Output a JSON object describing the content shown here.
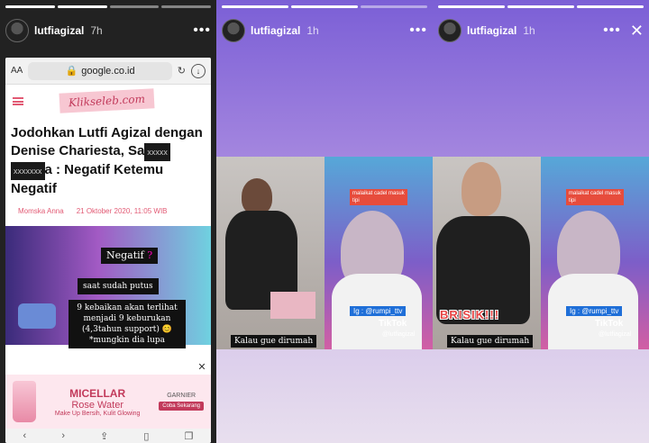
{
  "stories": [
    {
      "username": "lutfiagizal",
      "time": "7h",
      "more": "•••",
      "browser": {
        "aa_label": "AA",
        "url": "google.co.id",
        "reload_icon": "reload-icon",
        "download_icon": "download-icon",
        "logo": "Klikseleb.com",
        "headline_part1": "Jodohkan Lutfi Agizal dengan Denise Chariesta, Sa",
        "redact1": "xxxxx",
        "redact2": "xxxxxxx",
        "headline_part2": "a : Negatif Ketemu Negatif",
        "author": "Momska Anna",
        "date": "21 Oktober 2020, 11:05 WIB",
        "note1_prefix": "Negatif",
        "note1_q": "?",
        "note2": "saat sudah putus",
        "note3": "9 kebaikan akan terlihat menjadi 9 keburukan (4,3tahun support) 😊 *mungkin dia lupa",
        "ad": {
          "micellar": "MICELLAR",
          "rose": "Rose Water",
          "tagline": "Make Up Bersih, Kulit Glowing",
          "brand": "GARNIER",
          "cta": "Coba Sekarang",
          "close": "✕"
        }
      }
    },
    {
      "username": "lutfiagizal",
      "time": "1h",
      "more": "•••",
      "caption": "Kalau gue dirumah",
      "ig": "Ig : @rumpi_ttv",
      "tiktok": "TikTok",
      "tiktok_user": "@lutfiagizal",
      "malaikat": "malaikat cadel masuk tipi"
    },
    {
      "username": "lutfiagizal",
      "time": "1h",
      "more": "•••",
      "close": "✕",
      "caption": "Kalau gue dirumah",
      "ig": "Ig : @rumpi_ttv",
      "tiktok": "TikTok",
      "tiktok_user": "@lutfiagizal",
      "malaikat": "malaikat cadel masuk tipi",
      "brisik": "BRISIK!!!"
    }
  ]
}
